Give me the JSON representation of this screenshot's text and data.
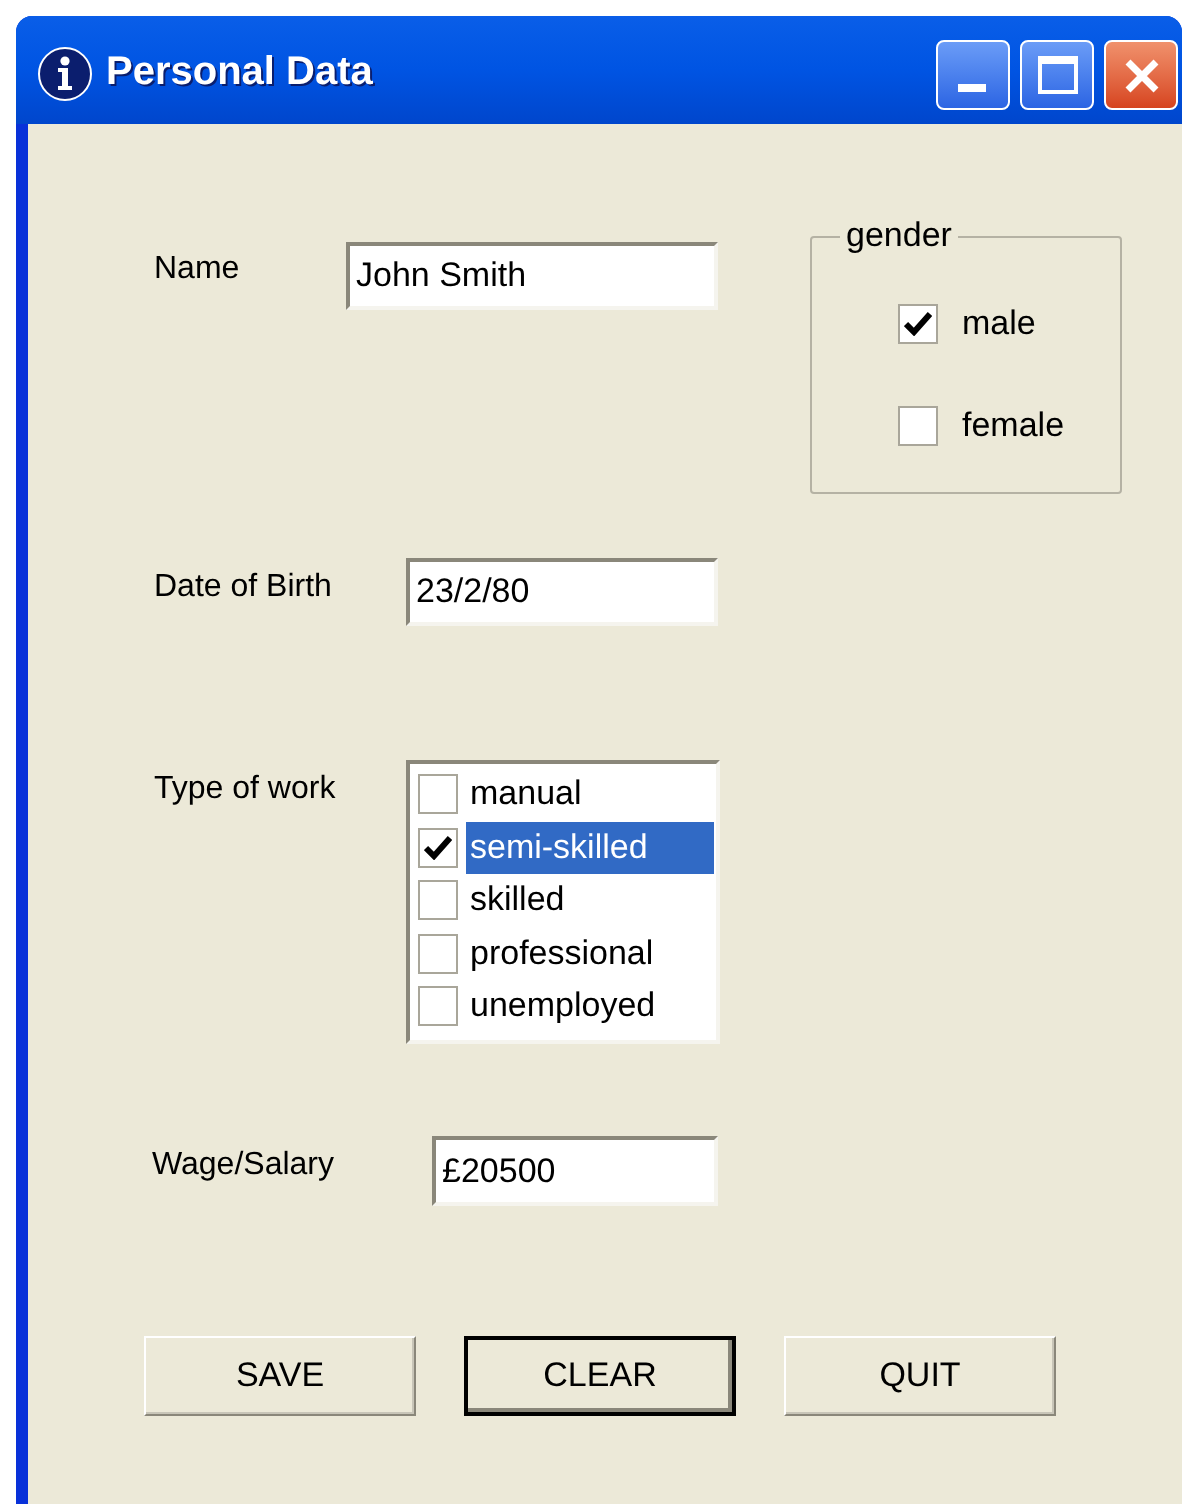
{
  "window": {
    "title": "Personal Data"
  },
  "name": {
    "label": "Name",
    "value": "John Smith"
  },
  "gender": {
    "legend": "gender",
    "options": [
      {
        "label": "male",
        "checked": true
      },
      {
        "label": "female",
        "checked": false
      }
    ]
  },
  "date_of_birth": {
    "label": "Date of Birth",
    "value": "23/2/80"
  },
  "type_of_work": {
    "label": "Type of work",
    "items": [
      {
        "label": "manual",
        "checked": false,
        "selected": false
      },
      {
        "label": "semi-skilled",
        "checked": true,
        "selected": true
      },
      {
        "label": "skilled",
        "checked": false,
        "selected": false
      },
      {
        "label": "professional",
        "checked": false,
        "selected": false
      },
      {
        "label": "unemployed",
        "checked": false,
        "selected": false
      }
    ]
  },
  "wage_salary": {
    "label": "Wage/Salary",
    "value": "£20500"
  },
  "buttons": [
    {
      "label": "SAVE",
      "focused": false
    },
    {
      "label": "CLEAR",
      "focused": true
    },
    {
      "label": "QUIT",
      "focused": false
    }
  ]
}
